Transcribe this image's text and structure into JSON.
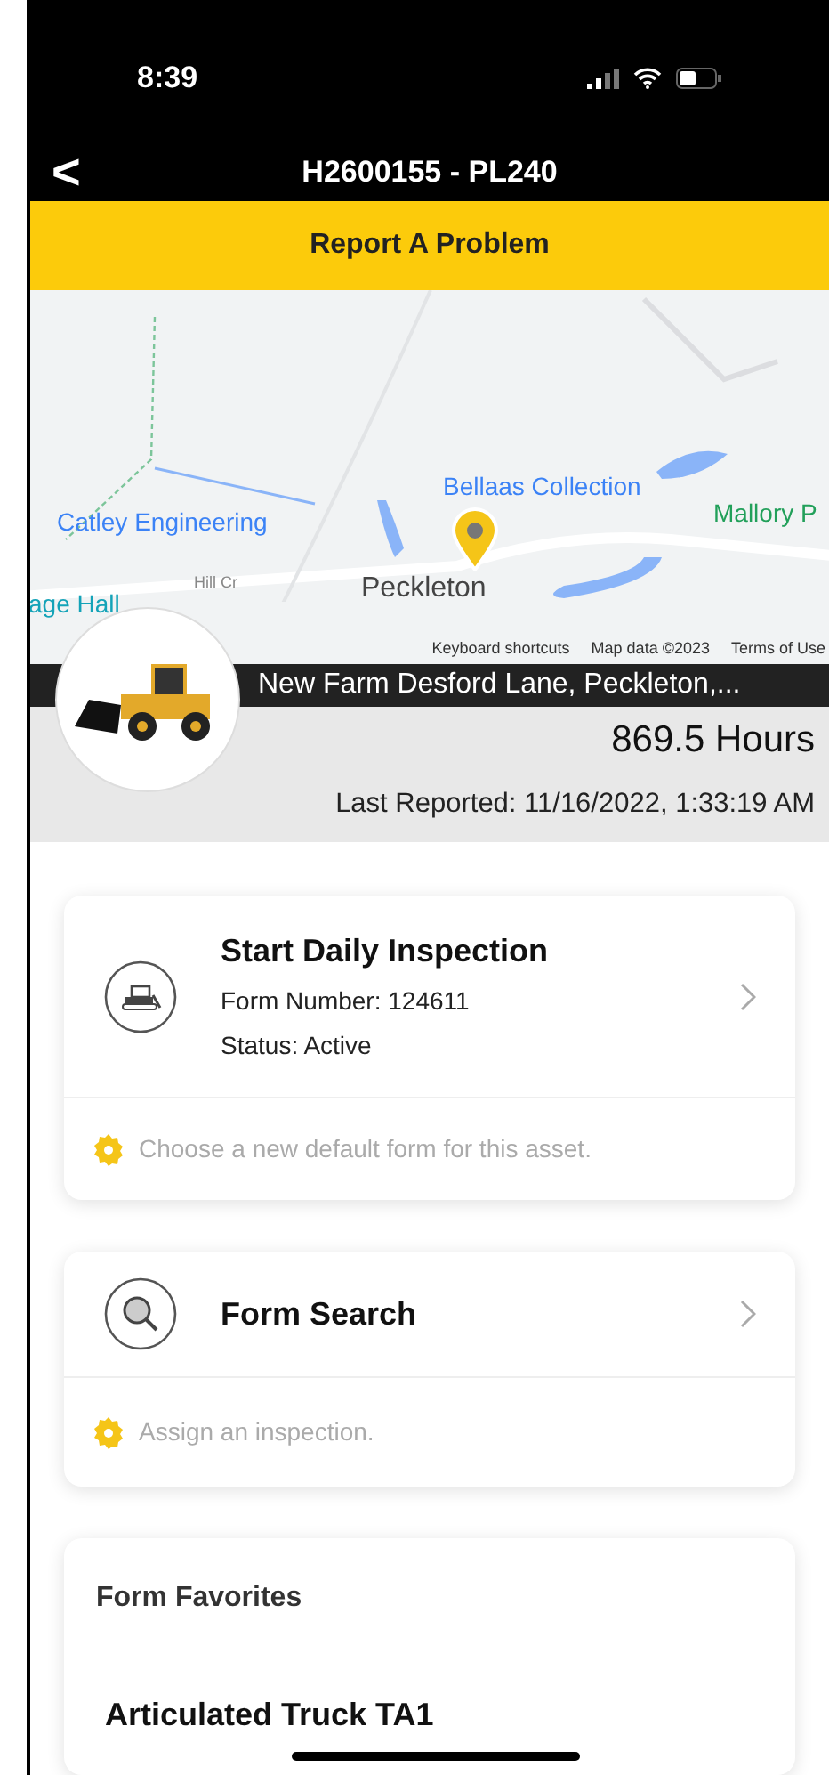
{
  "status_bar": {
    "time": "8:39"
  },
  "nav": {
    "back": "<",
    "title": "H2600155 - PL240"
  },
  "banner": {
    "label": "Report A Problem"
  },
  "map": {
    "labels": [
      {
        "text": "Catley Engineering",
        "kind": "poi",
        "color": "#3b82f6"
      },
      {
        "text": "Bellaas Collection",
        "kind": "poi",
        "color": "#3b82f6"
      },
      {
        "text": "Mallory P",
        "kind": "poi",
        "color": "#22a05a"
      },
      {
        "text": "Hill Cr",
        "kind": "street",
        "color": "#888888"
      },
      {
        "text": "Peckleton",
        "kind": "town",
        "color": "#444444"
      },
      {
        "text": "age Hall",
        "kind": "poi",
        "color": "#14a3b8"
      }
    ],
    "attribution": [
      "Keyboard shortcuts",
      "Map data ©2023",
      "Terms of Use"
    ]
  },
  "asset": {
    "address": "New Farm Desford Lane, Peckleton,...",
    "hours": "869.5 Hours",
    "last_reported": "Last Reported: 11/16/2022, 1:33:19 AM"
  },
  "cards": [
    {
      "kind": "inspection",
      "title": "Start Daily Inspection",
      "lines": [
        "Form Number: 124611",
        "Status: Active"
      ],
      "hint": "Choose a new default form for this asset."
    },
    {
      "kind": "search",
      "title": "Form Search",
      "hint": "Assign an inspection."
    }
  ],
  "favorites": {
    "heading": "Form Favorites",
    "items": [
      "Articulated Truck TA1"
    ]
  }
}
